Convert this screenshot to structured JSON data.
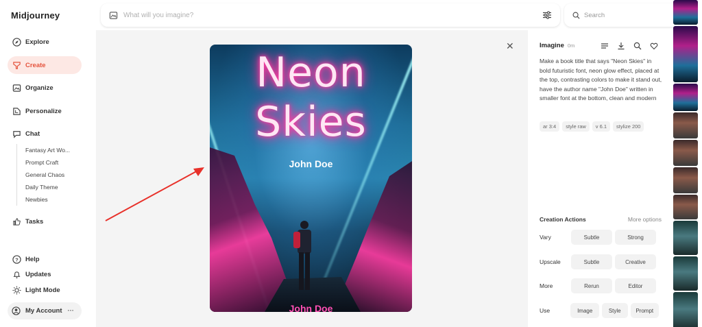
{
  "app": {
    "title": "Midjourney"
  },
  "nav": {
    "items": [
      {
        "label": "Explore",
        "icon": "compass-icon"
      },
      {
        "label": "Create",
        "icon": "brush-icon",
        "active": true
      },
      {
        "label": "Organize",
        "icon": "image-icon"
      },
      {
        "label": "Personalize",
        "icon": "personalize-icon"
      },
      {
        "label": "Chat",
        "icon": "chat-icon"
      }
    ],
    "chat_rooms": [
      "Fantasy Art Wo...",
      "Prompt Craft",
      "General Chaos",
      "Daily Theme",
      "Newbies"
    ],
    "tasks_label": "Tasks",
    "help_label": "Help",
    "updates_label": "Updates",
    "light_mode_label": "Light Mode",
    "account_label": "My Account",
    "account_more": "···"
  },
  "search": {
    "imagine_placeholder": "What will you imagine?",
    "search_placeholder": "Search"
  },
  "image": {
    "title_line1": "Neon",
    "title_line2": "Skies",
    "author_top": "John Doe",
    "author_bottom": "John Doe"
  },
  "details": {
    "title": "Imagine",
    "time": "0m",
    "prompt": "Make a book title that says \"Neon Skies\" in bold futuristic font, neon glow effect, placed at the top, contrasting colors to make it stand out, have the author name \"John Doe\" written in smaller font at the bottom, clean and modern",
    "tags": [
      "ar 3:4",
      "style raw",
      "v 6.1",
      "stylize 200"
    ]
  },
  "actions": {
    "heading": "Creation Actions",
    "more_options": "More options",
    "vary": {
      "label": "Vary",
      "buttons": [
        "Subtle",
        "Strong"
      ]
    },
    "upscale": {
      "label": "Upscale",
      "buttons": [
        "Subtle",
        "Creative"
      ]
    },
    "more": {
      "label": "More",
      "buttons": [
        "Rerun",
        "Editor"
      ]
    },
    "use": {
      "label": "Use",
      "buttons": [
        "Image",
        "Style",
        "Prompt"
      ]
    }
  },
  "colors": {
    "accent": "#e5533d",
    "active_bg": "#fde8e4",
    "neon_pink": "#ff3ba0",
    "arrow": "#e8312a"
  }
}
